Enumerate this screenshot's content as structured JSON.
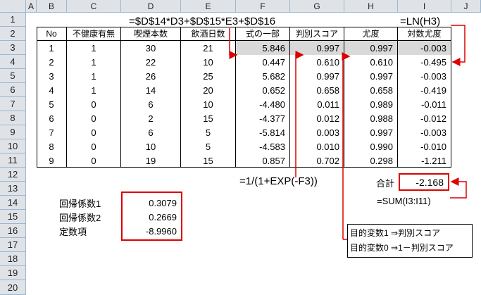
{
  "columns": [
    "A",
    "B",
    "C",
    "D",
    "E",
    "F",
    "G",
    "H",
    "I",
    "J"
  ],
  "rows": [
    "1",
    "2",
    "3",
    "4",
    "5",
    "6",
    "7",
    "8",
    "9",
    "10",
    "11",
    "12",
    "13",
    "14",
    "15",
    "16",
    "17",
    "18",
    "19",
    "20"
  ],
  "formulas": {
    "top_linear": "=$D$14*D3+$D$15*E3+$D$16",
    "top_ln": "=LN(H3)",
    "sigmoid": "=1/(1+EXP(-F3))",
    "sum": "=SUM(I3:I11)"
  },
  "table": {
    "headers": [
      "No",
      "不健康有無",
      "喫煙本数",
      "飲酒日数",
      "式の一部",
      "判別スコア",
      "尤度",
      "対数尤度"
    ],
    "rows": [
      [
        "1",
        "1",
        "30",
        "21",
        "5.846",
        "0.997",
        "0.997",
        "-0.003"
      ],
      [
        "2",
        "1",
        "22",
        "10",
        "0.447",
        "0.610",
        "0.610",
        "-0.495"
      ],
      [
        "3",
        "1",
        "26",
        "25",
        "5.682",
        "0.997",
        "0.997",
        "-0.003"
      ],
      [
        "4",
        "1",
        "14",
        "20",
        "0.652",
        "0.658",
        "0.658",
        "-0.419"
      ],
      [
        "5",
        "0",
        "6",
        "10",
        "-4.480",
        "0.011",
        "0.989",
        "-0.011"
      ],
      [
        "6",
        "0",
        "2",
        "15",
        "-4.377",
        "0.012",
        "0.988",
        "-0.012"
      ],
      [
        "7",
        "0",
        "6",
        "5",
        "-5.814",
        "0.003",
        "0.997",
        "-0.003"
      ],
      [
        "8",
        "0",
        "10",
        "5",
        "-4.583",
        "0.010",
        "0.990",
        "-0.010"
      ],
      [
        "9",
        "0",
        "19",
        "15",
        "0.857",
        "0.702",
        "0.298",
        "-1.211"
      ]
    ]
  },
  "total": {
    "label": "合計",
    "value": "-2.168"
  },
  "coefficients": [
    {
      "label": "回帰係数1",
      "value": "0.3079"
    },
    {
      "label": "回帰係数2",
      "value": "0.2669"
    },
    {
      "label": "定数項",
      "value": "-8.9960"
    }
  ],
  "note": {
    "line1": "目的変数1 ⇒判別スコア",
    "line2": "目的変数0 ⇒1－判別スコア"
  },
  "colors": {
    "highlight_border": "#dd0000",
    "header_bg": "#dfe3e8",
    "row_highlight": "#d9d9d9"
  }
}
